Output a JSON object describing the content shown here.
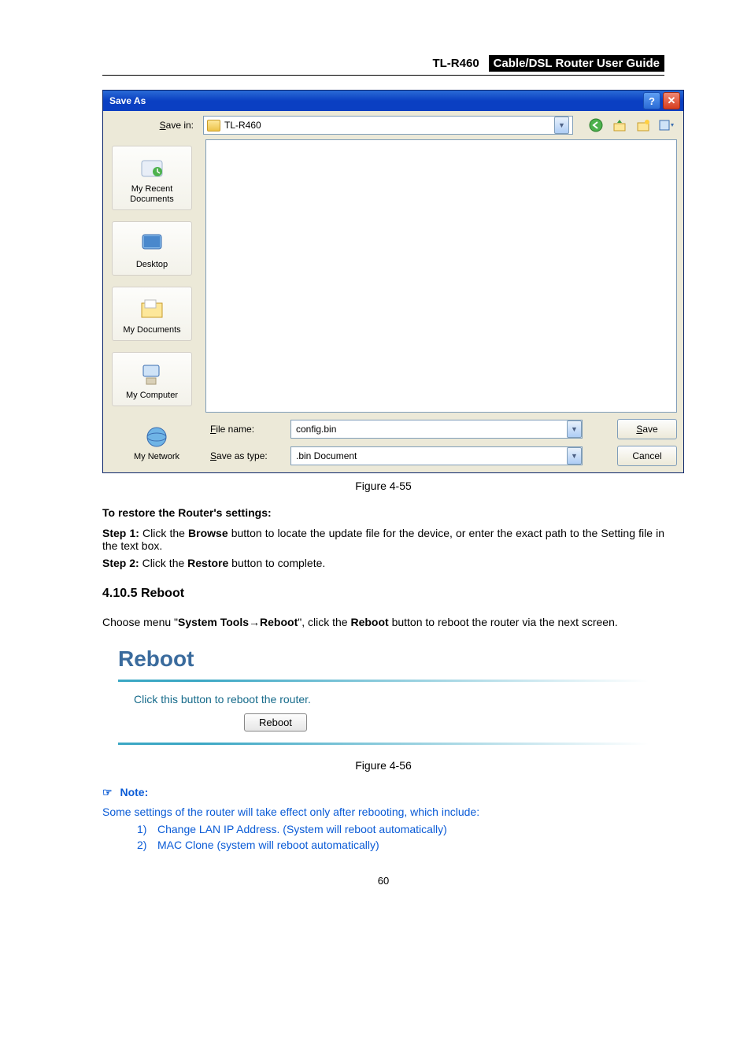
{
  "header": {
    "model": "TL-R460",
    "guide_title": "Cable/DSL Router User Guide"
  },
  "saveas": {
    "title": "Save As",
    "help_glyph": "?",
    "close_glyph": "✕",
    "save_in_label": "Save in:",
    "save_in_value": "TL-R460",
    "places": {
      "recent": "My Recent\nDocuments",
      "desktop": "Desktop",
      "mydocs": "My Documents",
      "mycomp": "My Computer",
      "mynetwork": "My Network"
    },
    "filename_label": "File name:",
    "filename_value": "config.bin",
    "savetype_label": "Save as type:",
    "savetype_value": ".bin Document",
    "save_btn": "Save",
    "cancel_btn": "Cancel"
  },
  "fig55": "Figure 4-55",
  "restore": {
    "heading": "To restore the Router's settings:",
    "step1_label": "Step 1:",
    "step1_a": "Click the ",
    "step1_browse": "Browse",
    "step1_b": " button to locate the update file for the device, or enter the exact path to the Setting file in the text box.",
    "step2_label": "Step 2:",
    "step2_a": "Click the ",
    "step2_restore": "Restore",
    "step2_b": " button to complete."
  },
  "section": {
    "number": "4.10.5",
    "title": "Reboot"
  },
  "choose_menu": {
    "a": "Choose menu \"",
    "systools": "System Tools",
    "arrow": "→",
    "reboot": "Reboot",
    "b": "\", click the ",
    "reboot2": "Reboot",
    "c": " button to reboot the router via the next screen."
  },
  "reboot_panel": {
    "title": "Reboot",
    "text": "Click this button to reboot the router.",
    "button": "Reboot"
  },
  "fig56": "Figure 4-56",
  "note": {
    "icon": "☞",
    "label": "Note:",
    "intro": "Some settings of the router will take effect only after rebooting, which include:",
    "item1_num": "1)",
    "item1": "Change LAN IP Address. (System will reboot automatically)",
    "item2_num": "2)",
    "item2": "MAC Clone (system will reboot automatically)"
  },
  "page_num": "60"
}
